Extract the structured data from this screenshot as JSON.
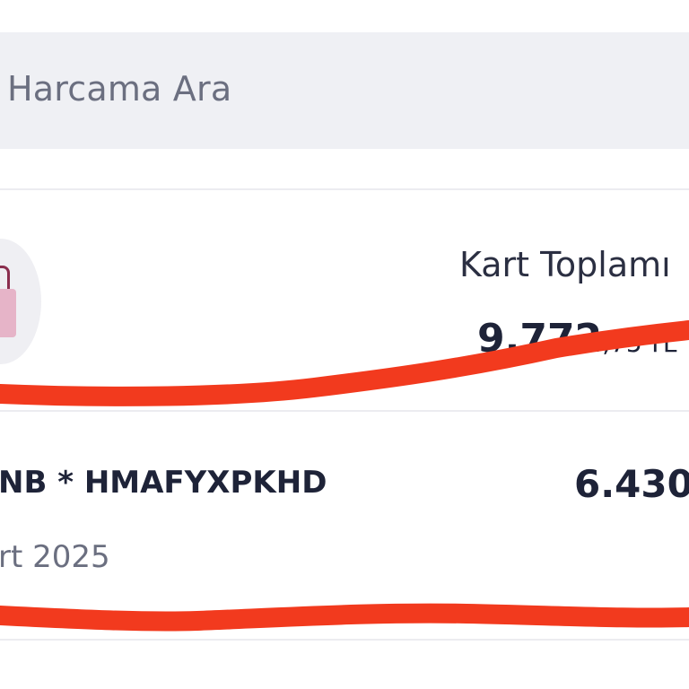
{
  "search": {
    "placeholder": "Harcama Ara"
  },
  "summary": {
    "label": "Kart Toplamı",
    "amount_main": "9.772",
    "amount_decimal": ",75",
    "currency": "TL"
  },
  "transaction": {
    "merchant": "NB * HMAFYXPKHD",
    "amount": "6.430",
    "date": "rt 2025"
  },
  "colors": {
    "scribble": "#f23a1e",
    "search_background": "#eff0f4",
    "primary_text": "#1e2338",
    "secondary_text": "#6b6f80"
  },
  "icons": {
    "avatar": "shopping-bag-icon"
  }
}
